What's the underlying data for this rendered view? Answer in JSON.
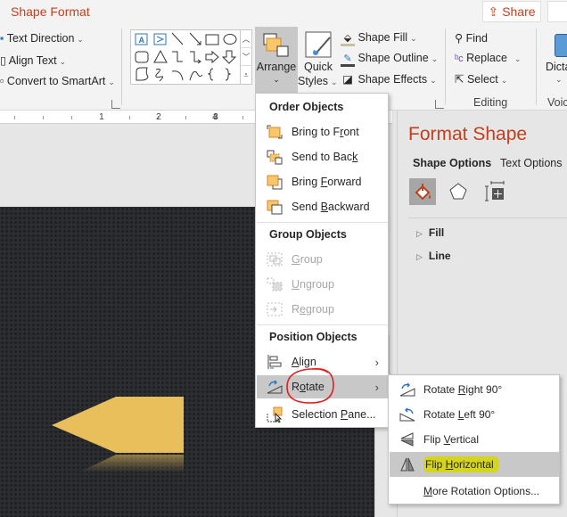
{
  "ribbon": {
    "tab_title": "Shape Format",
    "share_label": "Share",
    "text_group": {
      "text_direction": "Text Direction",
      "align_text": "Align Text",
      "convert_smartart": "Convert to SmartArt"
    },
    "arrange_label": "Arrange",
    "quick_styles_line1": "Quick",
    "quick_styles_line2": "Styles",
    "shape_fill": "Shape Fill",
    "shape_outline": "Shape Outline",
    "shape_effects": "Shape Effects",
    "find": "Find",
    "replace": "Replace",
    "select": "Select",
    "editing_group": "Editing",
    "dictate": "Dicta",
    "voice_group": "Voic"
  },
  "ruler": {
    "marks": [
      "1",
      "2",
      "3",
      "4"
    ]
  },
  "format_pane": {
    "title": "Format Shape",
    "tabs": [
      "Shape Options",
      "Text Options"
    ],
    "sections": [
      "Fill",
      "Line"
    ]
  },
  "arrange_menu": {
    "order_header": "Order Objects",
    "bring_to_front": {
      "pre": "Bring to F",
      "key": "r",
      "post": "ont"
    },
    "send_to_back": {
      "pre": "Send to Bac",
      "key": "k",
      "post": ""
    },
    "bring_forward": {
      "pre": "Bring ",
      "key": "F",
      "post": "orward"
    },
    "send_backward": {
      "pre": "Send ",
      "key": "B",
      "post": "ackward"
    },
    "group_header": "Group Objects",
    "group": {
      "pre": "",
      "key": "G",
      "post": "roup"
    },
    "ungroup": {
      "pre": "",
      "key": "U",
      "post": "ngroup"
    },
    "regroup": {
      "pre": "R",
      "key": "e",
      "post": "group"
    },
    "position_header": "Position Objects",
    "align": {
      "pre": "",
      "key": "A",
      "post": "lign"
    },
    "rotate": {
      "pre": "R",
      "key": "o",
      "post": "tate"
    },
    "selection_pane": {
      "pre": "Selection ",
      "key": "P",
      "post": "ane..."
    }
  },
  "rotate_menu": {
    "rotate_right": {
      "pre": "Rotate ",
      "key": "R",
      "post": "ight 90°"
    },
    "rotate_left": {
      "pre": "Rotate ",
      "key": "L",
      "post": "eft 90°"
    },
    "flip_vertical": {
      "pre": "Flip ",
      "key": "V",
      "post": "ertical"
    },
    "flip_horizontal": {
      "pre": "Flip ",
      "key": "H",
      "post": "orizontal"
    },
    "more_options": {
      "pre": "",
      "key": "M",
      "post": "ore Rotation Options..."
    }
  },
  "colors": {
    "accent": "#c43e1c",
    "shape_fill": "#e9bf5c",
    "highlight": "#d7d700",
    "annotation_circle": "#e02020"
  }
}
